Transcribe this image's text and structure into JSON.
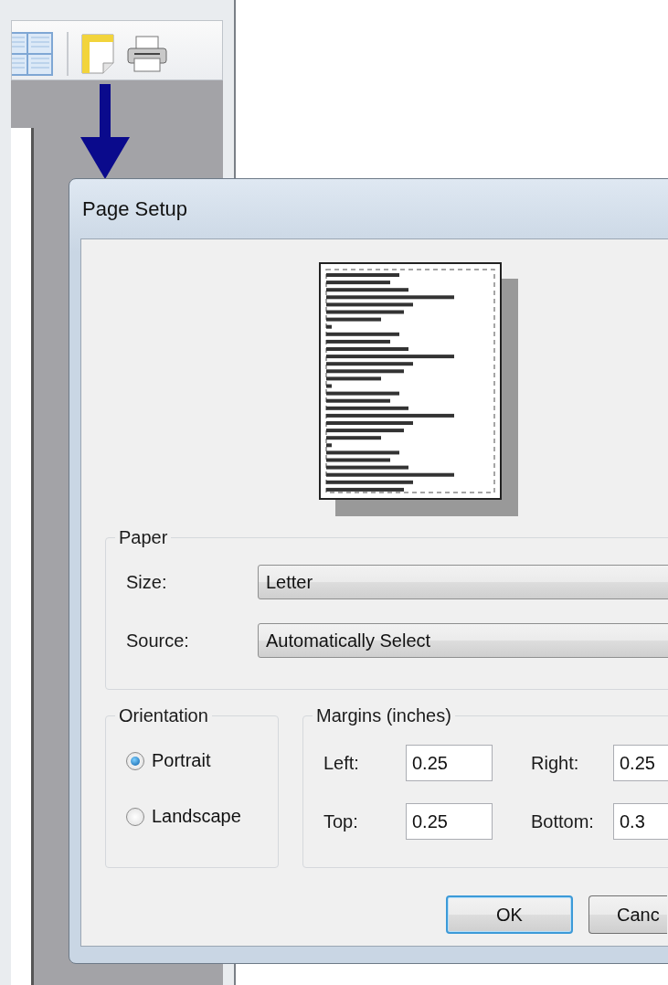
{
  "dialog": {
    "title": "Page Setup",
    "paper": {
      "legend": "Paper",
      "size": {
        "label": "Size:",
        "value": "Letter"
      },
      "source": {
        "label": "Source:",
        "value": "Automatically Select"
      }
    },
    "orientation": {
      "legend": "Orientation",
      "options": [
        {
          "label": "Portrait",
          "selected": true
        },
        {
          "label": "Landscape",
          "selected": false
        }
      ]
    },
    "margins": {
      "legend": "Margins (inches)",
      "fields": [
        {
          "label": "Left:",
          "value": "0.25"
        },
        {
          "label": "Right:",
          "value": "0.25"
        },
        {
          "label": "Top:",
          "value": "0.25"
        },
        {
          "label": "Bottom:",
          "value": "0.3"
        }
      ]
    },
    "buttons": [
      {
        "label": "OK",
        "default": true
      },
      {
        "label": "Canc",
        "default": false
      }
    ]
  }
}
